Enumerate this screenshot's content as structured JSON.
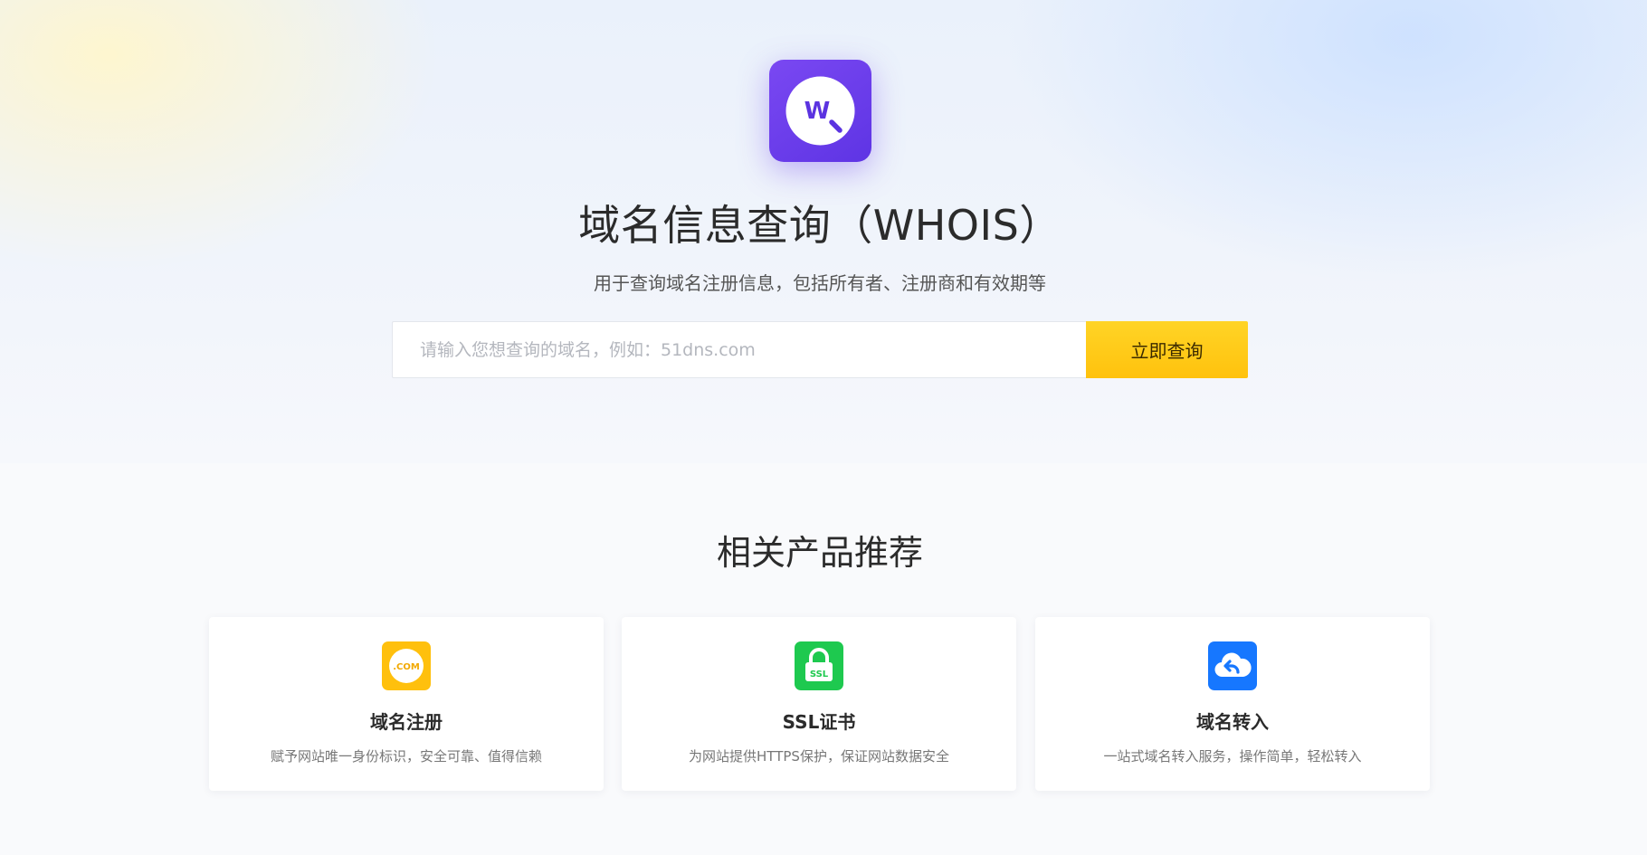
{
  "hero": {
    "logo_letter": "W",
    "title": "域名信息查询（WHOIS）",
    "subtitle": "用于查询域名注册信息，包括所有者、注册商和有效期等"
  },
  "search": {
    "value": "",
    "placeholder": "请输入您想查询的域名，例如：51dns.com",
    "button_label": "立即查询"
  },
  "products": {
    "title": "相关产品推荐",
    "items": [
      {
        "icon": "com-domain-icon",
        "icon_text": ".COM",
        "icon_color": "#ffc00d",
        "name": "域名注册",
        "desc": "赋予网站唯一身份标识，安全可靠、值得信赖"
      },
      {
        "icon": "ssl-lock-icon",
        "icon_text": "SSL",
        "icon_color": "#1ec94f",
        "name": "SSL证书",
        "desc": "为网站提供HTTPS保护，保证网站数据安全"
      },
      {
        "icon": "cloud-transfer-icon",
        "icon_color": "#1677ff",
        "name": "域名转入",
        "desc": "一站式域名转入服务，操作简单，轻松转入"
      }
    ]
  },
  "colors": {
    "brand_purple": "#6a3ced",
    "search_button": "#ffc20d"
  }
}
